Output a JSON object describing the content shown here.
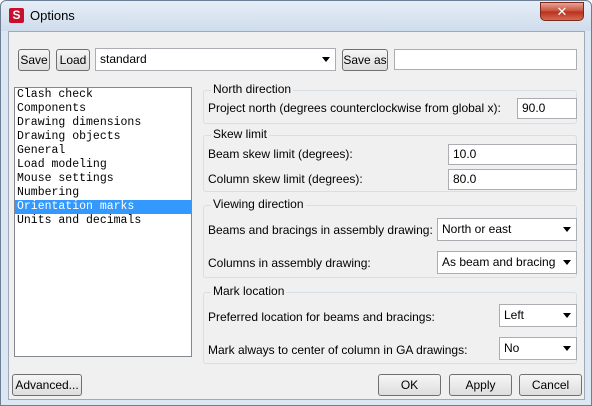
{
  "window": {
    "title": "Options",
    "close_glyph": "✕"
  },
  "toolbar": {
    "save_label": "Save",
    "load_label": "Load",
    "preset_value": "standard",
    "saveas_label": "Save as",
    "saveas_value": ""
  },
  "categories": [
    "Clash check",
    "Components",
    "Drawing dimensions",
    "Drawing objects",
    "General",
    "Load modeling",
    "Mouse settings",
    "Numbering",
    "Orientation marks",
    "Units and decimals"
  ],
  "selected_category": "Orientation marks",
  "north_direction": {
    "title": "North direction",
    "project_north_label": "Project north (degrees counterclockwise from global x):",
    "project_north_value": "90.0"
  },
  "skew_limit": {
    "title": "Skew limit",
    "beam_label": "Beam skew limit (degrees):",
    "beam_value": "10.0",
    "column_label": "Column skew limit (degrees):",
    "column_value": "80.0"
  },
  "viewing_direction": {
    "title": "Viewing direction",
    "beams_label": "Beams and bracings in assembly drawing:",
    "beams_value": "North or east",
    "columns_label": "Columns in assembly drawing:",
    "columns_value": "As beam and bracing"
  },
  "mark_location": {
    "title": "Mark location",
    "preferred_label": "Preferred location for beams and bracings:",
    "preferred_value": "Left",
    "center_label": "Mark always to center of column in GA drawings:",
    "center_value": "No"
  },
  "footer": {
    "advanced_label": "Advanced...",
    "ok_label": "OK",
    "apply_label": "Apply",
    "cancel_label": "Cancel"
  }
}
